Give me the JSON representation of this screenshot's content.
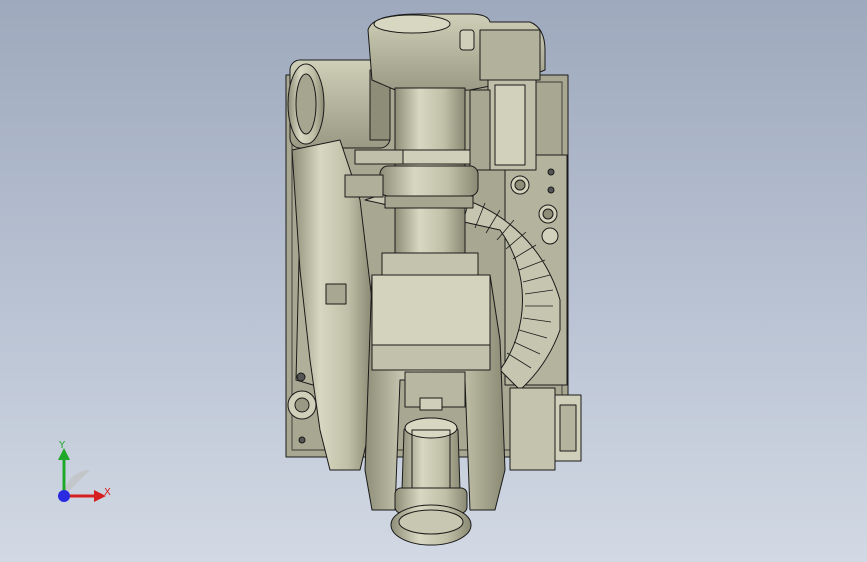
{
  "colors": {
    "background_top": "#9ea9bd",
    "background_bottom": "#d2d9e4",
    "metal_light": "#d8d8c2",
    "metal_mid": "#b7b7a0",
    "metal_dark": "#8e8e78",
    "edge": "#1a1a1a",
    "axis_x": "#d62020",
    "axis_y": "#1fa82a",
    "axis_z": "#2a2ae0"
  },
  "triad": {
    "x_label": "X",
    "y_label": "Y"
  }
}
